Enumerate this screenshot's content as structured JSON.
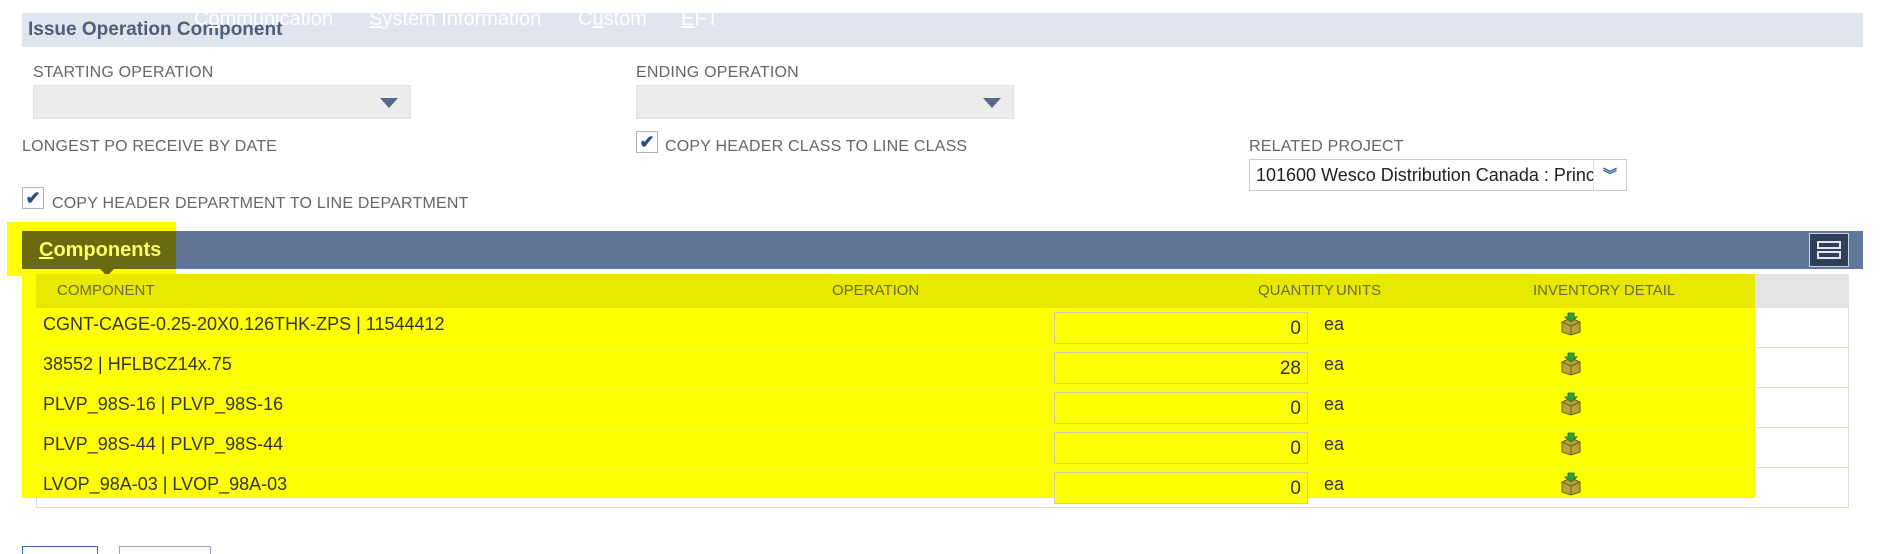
{
  "section": {
    "title": "Issue Operation Component"
  },
  "fields": {
    "starting_operation_label": "STARTING OPERATION",
    "starting_operation_value": "",
    "ending_operation_label": "ENDING OPERATION",
    "ending_operation_value": "",
    "longest_po_label": "LONGEST PO RECEIVE BY DATE",
    "copy_class_label": "COPY HEADER CLASS TO LINE CLASS",
    "copy_class_checked": true,
    "copy_dept_label": "COPY HEADER DEPARTMENT TO LINE DEPARTMENT",
    "copy_dept_checked": true,
    "related_project_label": "RELATED PROJECT",
    "related_project_value": "101600 Wesco Distribution Canada : Princ"
  },
  "tabs": [
    {
      "label": "Components",
      "access_key": "C",
      "active": true
    },
    {
      "label": "Communication",
      "access_key": "o",
      "active": false
    },
    {
      "label": "System Information",
      "access_key": "S",
      "active": false
    },
    {
      "label": "Custom",
      "access_key": "u",
      "active": false
    },
    {
      "label": "EFT",
      "access_key": "E",
      "active": false
    }
  ],
  "grid": {
    "columns": [
      "COMPONENT",
      "OPERATION",
      "QUANTITY",
      "UNITS",
      "INVENTORY DETAIL"
    ],
    "rows": [
      {
        "component": "CGNT-CAGE-0.25-20X0.126THK-ZPS | 11544412",
        "operation": "",
        "quantity": "0",
        "units": "ea",
        "inventory_icon": "inventory-detail-icon"
      },
      {
        "component": "38552 | HFLBCZ14x.75",
        "operation": "",
        "quantity": "28",
        "units": "ea",
        "inventory_icon": "inventory-detail-icon"
      },
      {
        "component": "PLVP_98S-16 | PLVP_98S-16",
        "operation": "",
        "quantity": "0",
        "units": "ea",
        "inventory_icon": "inventory-detail-icon"
      },
      {
        "component": "PLVP_98S-44 | PLVP_98S-44",
        "operation": "",
        "quantity": "0",
        "units": "ea",
        "inventory_icon": "inventory-detail-icon"
      },
      {
        "component": "LVOP_98A-03 | LVOP_98A-03",
        "operation": "",
        "quantity": "0",
        "units": "ea",
        "inventory_icon": "inventory-detail-icon"
      }
    ]
  },
  "colors": {
    "header_bg": "#e0e6ef",
    "tabbar_bg": "#607799",
    "highlight": "#ffff00",
    "checkmark": "#2a4e86"
  }
}
